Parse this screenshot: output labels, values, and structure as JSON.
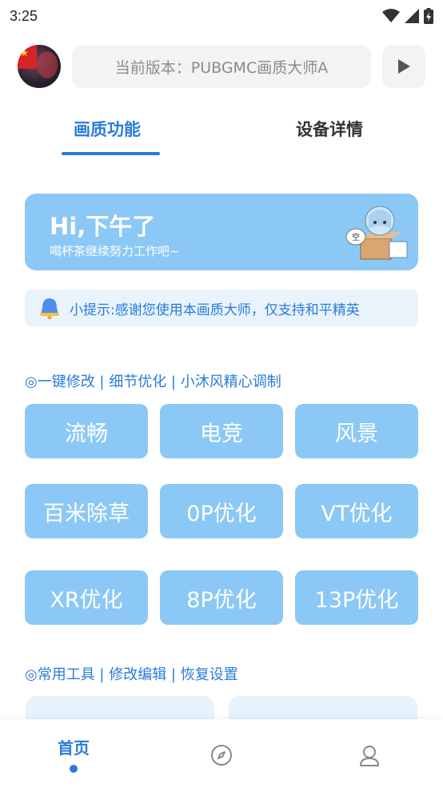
{
  "status": {
    "time": "3:25"
  },
  "header": {
    "version_text": "当前版本：PUBGMC画质大师A"
  },
  "tabs": [
    {
      "label": "画质功能",
      "active": true
    },
    {
      "label": "设备详情",
      "active": false
    }
  ],
  "banner": {
    "title": "Hi,下午了",
    "subtitle": "喝杯茶继续努力工作吧~",
    "art_badge": "空"
  },
  "notice": {
    "text": "小提示:感谢您使用本画质大师，仅支持和平精英"
  },
  "section_quick": {
    "title": "◎一键修改 | 细节优化 | 小沐风精心调制",
    "buttons": [
      "流畅",
      "电竞",
      "风景",
      "百米除草",
      "0P优化",
      "VT优化",
      "XR优化",
      "8P优化",
      "13P优化"
    ]
  },
  "section_tools": {
    "title": "◎常用工具 | 修改编辑 | 恢复设置"
  },
  "bottom_nav": {
    "home_label": "首页",
    "accent": "#2a7bd8"
  },
  "colors": {
    "accent": "#2a7bd8",
    "button_bg": "#8cc8f5",
    "notice_bg": "#e8f3fc"
  }
}
